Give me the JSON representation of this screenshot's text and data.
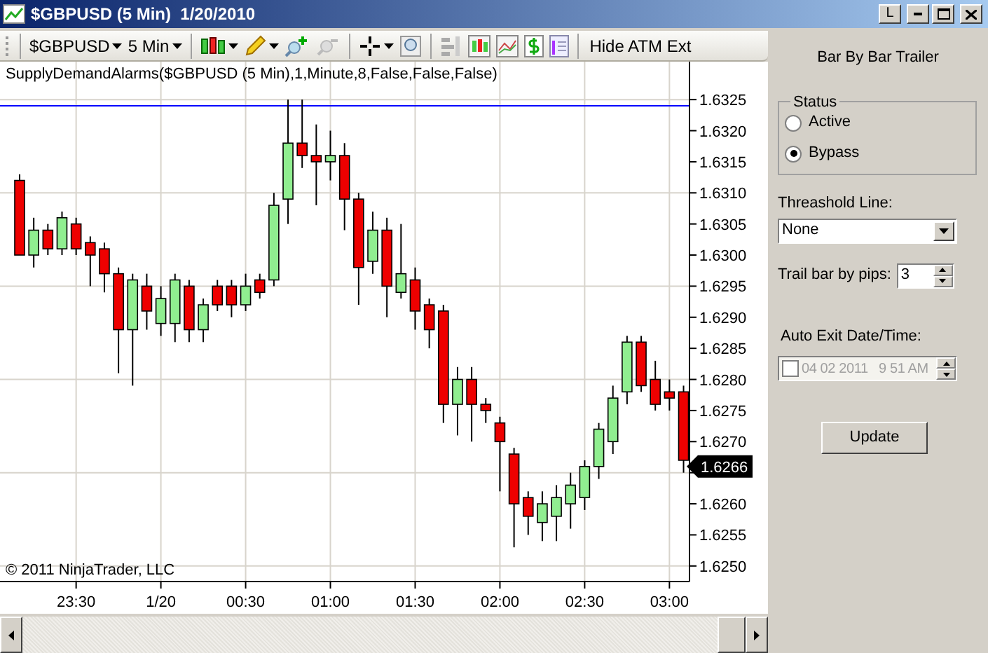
{
  "window": {
    "title": "$GBPUSD (5 Min)  1/20/2010",
    "buttons": [
      "L"
    ]
  },
  "toolbar": {
    "instrument": "$GBPUSD",
    "interval": "5 Min",
    "atm_button": "Hide ATM Ext"
  },
  "chart": {
    "indicator_label": "SupplyDemandAlarms($GBPUSD (5 Min),1,Minute,8,False,False,False)",
    "copyright": "© 2011 NinjaTrader, LLC",
    "last_price": "1.6266",
    "chart_data": {
      "type": "candlestick",
      "ylim": [
        1.62475,
        1.63311
      ],
      "grid": true,
      "ref_lines": [
        {
          "axis": "y",
          "value": 1.6324,
          "color": "#0000ff"
        }
      ],
      "categories": [
        null,
        null,
        null,
        null,
        "23:30",
        null,
        null,
        null,
        null,
        null,
        "1/20",
        null,
        null,
        null,
        null,
        null,
        "00:30",
        null,
        null,
        null,
        null,
        null,
        "01:00",
        null,
        null,
        null,
        null,
        null,
        "01:30",
        null,
        null,
        null,
        null,
        null,
        "02:00",
        null,
        null,
        null,
        null,
        null,
        "02:30",
        null,
        null,
        null,
        null,
        null,
        "03:00",
        null
      ],
      "yticks": [
        {
          "value": 1.6325,
          "label": "1.6325"
        },
        {
          "value": 1.632,
          "label": "1.6320"
        },
        {
          "value": 1.6315,
          "label": "1.6315"
        },
        {
          "value": 1.631,
          "label": "1.6310"
        },
        {
          "value": 1.6305,
          "label": "1.6305"
        },
        {
          "value": 1.63,
          "label": "1.6300"
        },
        {
          "value": 1.6295,
          "label": "1.6295"
        },
        {
          "value": 1.629,
          "label": "1.6290"
        },
        {
          "value": 1.6285,
          "label": "1.6285"
        },
        {
          "value": 1.628,
          "label": "1.6280"
        },
        {
          "value": 1.6275,
          "label": "1.6275"
        },
        {
          "value": 1.627,
          "label": "1.6270"
        },
        {
          "value": 1.626,
          "label": "1.6260"
        },
        {
          "value": 1.6255,
          "label": "1.6255"
        },
        {
          "value": 1.625,
          "label": "1.6250"
        }
      ],
      "ohlc": [
        [
          1.6312,
          1.6313,
          1.63,
          1.63
        ],
        [
          1.63,
          1.6306,
          1.6298,
          1.6304
        ],
        [
          1.6304,
          1.6305,
          1.63,
          1.6301
        ],
        [
          1.6301,
          1.6307,
          1.63,
          1.6306
        ],
        [
          1.6305,
          1.6306,
          1.63,
          1.6301
        ],
        [
          1.6302,
          1.6303,
          1.6295,
          1.63
        ],
        [
          1.6301,
          1.6302,
          1.6294,
          1.6297
        ],
        [
          1.6297,
          1.6298,
          1.6281,
          1.6288
        ],
        [
          1.6288,
          1.6297,
          1.6279,
          1.6296
        ],
        [
          1.6295,
          1.6297,
          1.6288,
          1.6291
        ],
        [
          1.6289,
          1.6295,
          1.6287,
          1.6293
        ],
        [
          1.6289,
          1.6297,
          1.6286,
          1.6296
        ],
        [
          1.6295,
          1.6296,
          1.6286,
          1.6288
        ],
        [
          1.6288,
          1.6293,
          1.6286,
          1.6292
        ],
        [
          1.6295,
          1.6296,
          1.6291,
          1.6292
        ],
        [
          1.6295,
          1.6296,
          1.629,
          1.6292
        ],
        [
          1.6292,
          1.6297,
          1.6291,
          1.6295
        ],
        [
          1.6296,
          1.6297,
          1.6293,
          1.6294
        ],
        [
          1.6296,
          1.631,
          1.6295,
          1.6308
        ],
        [
          1.6309,
          1.6325,
          1.6305,
          1.6318
        ],
        [
          1.6318,
          1.6325,
          1.6314,
          1.6316
        ],
        [
          1.6316,
          1.6321,
          1.6308,
          1.6315
        ],
        [
          1.6315,
          1.632,
          1.6312,
          1.6316
        ],
        [
          1.6316,
          1.6318,
          1.6304,
          1.6309
        ],
        [
          1.6309,
          1.631,
          1.6292,
          1.6298
        ],
        [
          1.6299,
          1.6307,
          1.6297,
          1.6304
        ],
        [
          1.6304,
          1.6306,
          1.629,
          1.6295
        ],
        [
          1.6294,
          1.6305,
          1.6293,
          1.6297
        ],
        [
          1.6296,
          1.6298,
          1.6288,
          1.6291
        ],
        [
          1.6292,
          1.6293,
          1.6285,
          1.6288
        ],
        [
          1.6291,
          1.6292,
          1.6273,
          1.6276
        ],
        [
          1.6276,
          1.6282,
          1.6271,
          1.628
        ],
        [
          1.628,
          1.6282,
          1.627,
          1.6276
        ],
        [
          1.6276,
          1.6277,
          1.6273,
          1.6275
        ],
        [
          1.6273,
          1.6274,
          1.6262,
          1.627
        ],
        [
          1.6268,
          1.6269,
          1.6253,
          1.626
        ],
        [
          1.6261,
          1.6262,
          1.6255,
          1.6258
        ],
        [
          1.6257,
          1.6262,
          1.6254,
          1.626
        ],
        [
          1.6258,
          1.6263,
          1.6254,
          1.6261
        ],
        [
          1.626,
          1.6265,
          1.6256,
          1.6263
        ],
        [
          1.6261,
          1.6267,
          1.6259,
          1.6266
        ],
        [
          1.6266,
          1.6273,
          1.6264,
          1.6272
        ],
        [
          1.627,
          1.6279,
          1.6268,
          1.6277
        ],
        [
          1.6278,
          1.6287,
          1.6276,
          1.6286
        ],
        [
          1.6286,
          1.6287,
          1.6278,
          1.6279
        ],
        [
          1.628,
          1.6283,
          1.6275,
          1.6276
        ],
        [
          1.6278,
          1.628,
          1.6275,
          1.6277
        ],
        [
          1.6278,
          1.6279,
          1.6265,
          1.6267
        ]
      ]
    }
  },
  "panel": {
    "title": "Bar By Bar Trailer",
    "status": {
      "label": "Status",
      "options": [
        {
          "label": "Active",
          "selected": false
        },
        {
          "label": "Bypass",
          "selected": true
        }
      ]
    },
    "threshold": {
      "label": "Threashold Line:",
      "value": "None"
    },
    "trail": {
      "label": "Trail bar by pips:",
      "value": "3"
    },
    "auto_exit": {
      "label": "Auto Exit Date/Time:",
      "checked": false,
      "disabled": true,
      "value": "04 02 2011   9 51 AM"
    },
    "update_button": "Update"
  }
}
